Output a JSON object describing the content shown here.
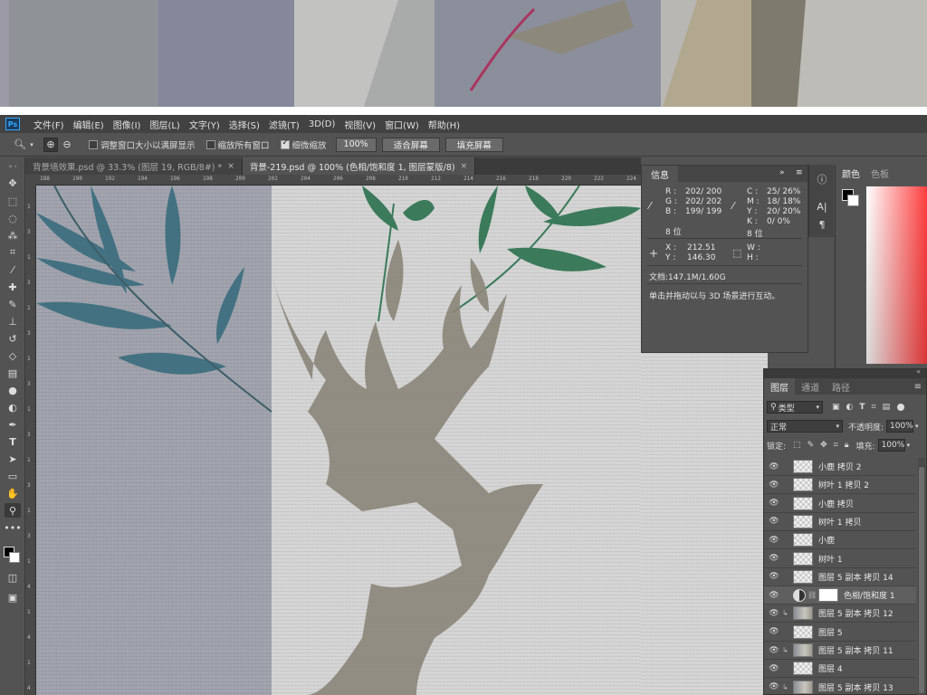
{
  "menu": [
    "文件(F)",
    "编辑(E)",
    "图像(I)",
    "图层(L)",
    "文字(Y)",
    "选择(S)",
    "滤镜(T)",
    "3D(D)",
    "视图(V)",
    "窗口(W)",
    "帮助(H)"
  ],
  "options_bar": {
    "resize_windows_label": "调整窗口大小以满屏显示",
    "zoom_all_label": "缩放所有窗口",
    "scrubby_zoom_label": "细微缩放",
    "zoom_value": "100%",
    "fit_screen_label": "适合屏幕",
    "fill_screen_label": "填充屏幕",
    "resize_windows_checked": false,
    "zoom_all_checked": false,
    "scrubby_zoom_checked": true
  },
  "tabs": [
    {
      "label": "背景墙效果.psd @ 33.3% (图层 19, RGB/8#) *",
      "active": false
    },
    {
      "label": "背景-219.psd @ 100% (色相/饱和度 1, 图层蒙版/8)",
      "active": true
    }
  ],
  "ruler": {
    "h_ticks": [
      "188",
      "190",
      "192",
      "194",
      "196",
      "198",
      "200",
      "202",
      "204",
      "206",
      "208",
      "210",
      "212",
      "214",
      "216",
      "218",
      "220",
      "222",
      "224"
    ],
    "v_ticks": [
      "1",
      "3",
      "1",
      "3",
      "1",
      "3",
      "1",
      "3",
      "1",
      "3",
      "1",
      "3",
      "1",
      "3",
      "1",
      "4",
      "1",
      "4",
      "1",
      "4"
    ]
  },
  "info_panel": {
    "tab": "信息",
    "rgb": {
      "R": "202/ 200",
      "G": "202/ 202",
      "B": "199/ 199"
    },
    "rgb_labels": [
      "R :",
      "G :",
      "B :"
    ],
    "cmyk": {
      "C": "25/ 26%",
      "M": "18/ 18%",
      "Y": "20/ 20%",
      "K": "0/ 0%"
    },
    "cmyk_labels": [
      "C :",
      "M :",
      "Y :",
      "K :"
    ],
    "bit_left": "8 位",
    "bit_right": "8 位",
    "x_label": "X :",
    "y_label": "Y :",
    "x": "212.51",
    "y": "146.30",
    "w_label": "W :",
    "h_label": "H :",
    "doc": "文档:147.1M/1.60G",
    "hint": "单击并拖动以与 3D 场景进行互动。",
    "expand_label": "»"
  },
  "color_panel": {
    "tabs": [
      "颜色",
      "色板"
    ]
  },
  "layers_panel": {
    "tabs": [
      "图层",
      "通道",
      "路径"
    ],
    "filter_label": "类型",
    "blend_mode": "正常",
    "opacity_label": "不透明度:",
    "opacity": "100%",
    "lock_label": "锁定:",
    "fill_label": "填充:",
    "fill": "100%",
    "layers": [
      {
        "name": "小鹿 拷贝 2",
        "thumb": "transparent",
        "clip": false,
        "selected": false
      },
      {
        "name": "树叶 1 拷贝 2",
        "thumb": "transparent",
        "clip": false,
        "selected": false
      },
      {
        "name": "小鹿 拷贝",
        "thumb": "transparent",
        "clip": false,
        "selected": false
      },
      {
        "name": "树叶 1 拷贝",
        "thumb": "transparent",
        "clip": false,
        "selected": false
      },
      {
        "name": "小鹿",
        "thumb": "transparent",
        "clip": false,
        "selected": false
      },
      {
        "name": "树叶 1",
        "thumb": "transparent",
        "clip": false,
        "selected": false
      },
      {
        "name": "图层 5 副本 拷贝 14",
        "thumb": "transparent",
        "clip": false,
        "selected": false
      },
      {
        "name": "色相/饱和度 1",
        "thumb": "adjustment",
        "clip": false,
        "selected": true
      },
      {
        "name": "图层 5 副本 拷贝 12",
        "thumb": "photo",
        "clip": true,
        "selected": false
      },
      {
        "name": "图层 5",
        "thumb": "transparent",
        "clip": false,
        "selected": false
      },
      {
        "name": "图层 5 副本 拷贝 11",
        "thumb": "photo",
        "clip": true,
        "selected": false
      },
      {
        "name": "图层 4",
        "thumb": "transparent",
        "clip": false,
        "selected": false
      },
      {
        "name": "图层 5 副本 拷贝 13",
        "thumb": "photo",
        "clip": true,
        "selected": false
      }
    ]
  },
  "tools": [
    "move-icon",
    "marquee-icon",
    "lasso-icon",
    "quick-select-icon",
    "crop-icon",
    "eyedropper-icon",
    "healing-icon",
    "brush-icon",
    "stamp-icon",
    "history-brush-icon",
    "eraser-icon",
    "gradient-icon",
    "blur-icon",
    "dodge-icon",
    "pen-icon",
    "type-icon",
    "path-select-icon",
    "rectangle-icon",
    "hand-icon",
    "zoom-icon",
    "more-icon"
  ]
}
